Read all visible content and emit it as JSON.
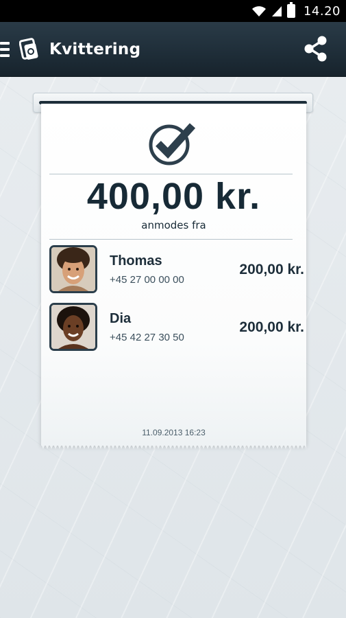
{
  "status_bar": {
    "time": "14.20",
    "icons": [
      "wifi-icon",
      "signal-icon",
      "battery-icon"
    ]
  },
  "action_bar": {
    "title": "Kvittering",
    "icons": [
      "hamburger-icon",
      "app-logo-icon",
      "share-icon"
    ]
  },
  "receipt": {
    "status_icon": "checkmark-icon",
    "total": "400,00 kr.",
    "subtitle": "anmodes fra",
    "people": [
      {
        "name": "Thomas",
        "phone": "+45 27 00 00 00",
        "amount": "200,00 kr.",
        "avatar": "avatar-photo"
      },
      {
        "name": "Dia",
        "phone": "+45 42 27 30 50",
        "amount": "200,00 kr.",
        "avatar": "avatar-photo"
      }
    ],
    "timestamp": "11.09.2013 16:23"
  },
  "colors": {
    "action_bar": "#1f2e39",
    "text_dark": "#172a36",
    "background": "#e7ecef"
  }
}
